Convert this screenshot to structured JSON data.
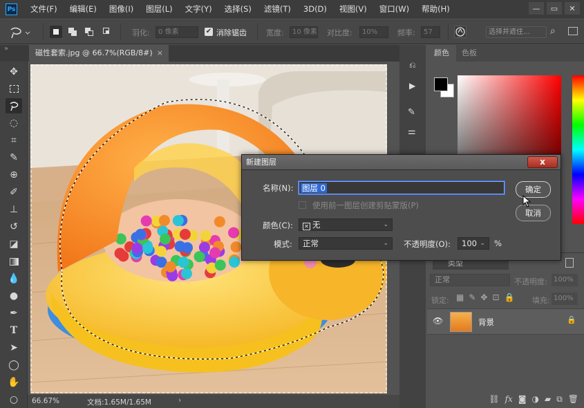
{
  "menubar": {
    "logo": "Ps",
    "items": [
      "文件(F)",
      "编辑(E)",
      "图像(I)",
      "图层(L)",
      "文字(Y)",
      "选择(S)",
      "滤镜(T)",
      "3D(D)",
      "视图(V)",
      "窗口(W)",
      "帮助(H)"
    ]
  },
  "options": {
    "feather_label": "羽化:",
    "feather_value": "0 像素",
    "antialias_label": "消除锯齿",
    "width_label": "宽度:",
    "width_value": "10 像素",
    "contrast_label": "对比度:",
    "contrast_value": "10%",
    "frequency_label": "频率:",
    "frequency_value": "57",
    "select_mask_label": "选择并遮住..."
  },
  "document": {
    "tab_title": "磁性套索.jpg @ 66.7%(RGB/8#)",
    "tab_close": "×",
    "zoom": "66.67%",
    "doc_info": "文档:1.65M/1.65M",
    "status_arrow": "›"
  },
  "color_panel": {
    "tabs": [
      "颜色",
      "色板"
    ]
  },
  "layers_panel": {
    "kind_label": "类型",
    "blend_mode": "正常",
    "opacity_label": "不透明度:",
    "opacity_value": "100%",
    "lock_label": "锁定:",
    "fill_label": "填充:",
    "fill_value": "100%",
    "layer_name": "背景"
  },
  "dialog": {
    "title": "新建图层",
    "close": "x",
    "name_label": "名称(N):",
    "name_value": "图层 0",
    "clip_label": "使用前一图层创建剪贴蒙版(P)",
    "color_label": "颜色(C):",
    "color_value": "无",
    "mode_label": "模式:",
    "mode_value": "正常",
    "opacity_label": "不透明度(O):",
    "opacity_value": "100",
    "opacity_unit": "%",
    "ok_label": "确定",
    "cancel_label": "取消"
  }
}
